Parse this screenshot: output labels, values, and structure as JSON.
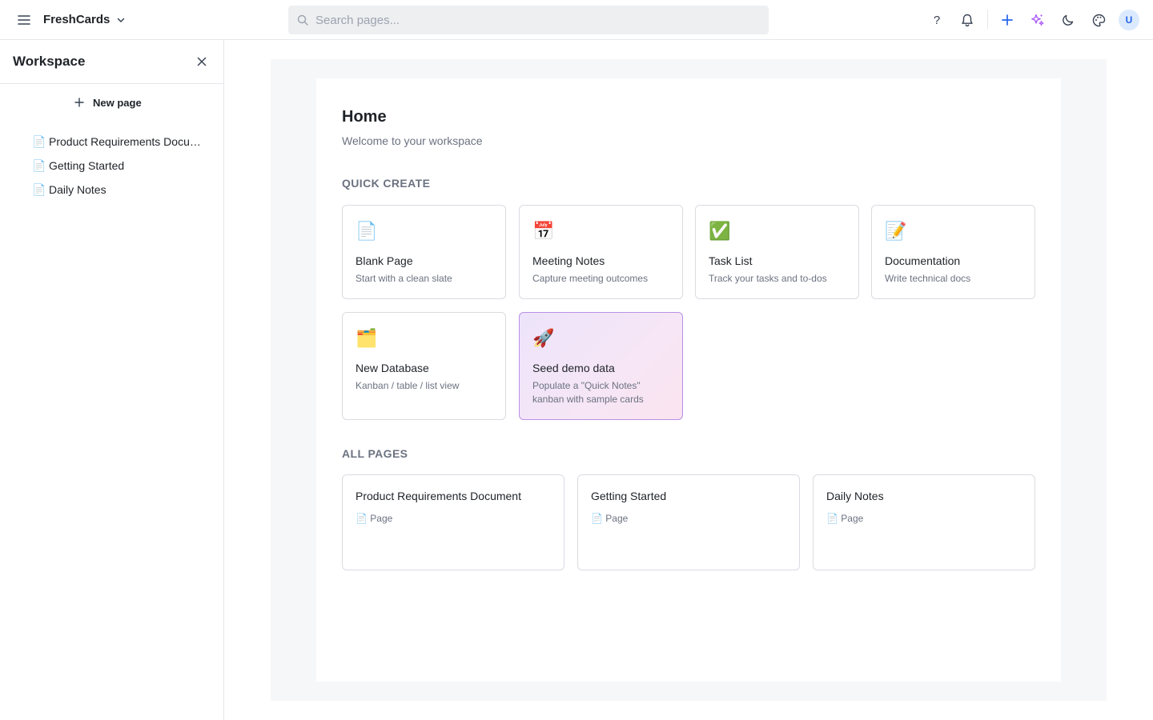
{
  "topbar": {
    "brand": "FreshCards",
    "search_placeholder": "Search pages...",
    "help_label": "?",
    "avatar_initial": "U"
  },
  "sidebar": {
    "title": "Workspace",
    "new_page_label": "New page",
    "pages": [
      {
        "icon": "📄",
        "label": "Product Requirements Document"
      },
      {
        "icon": "📄",
        "label": "Getting Started"
      },
      {
        "icon": "📄",
        "label": "Daily Notes"
      }
    ]
  },
  "main": {
    "title": "Home",
    "subtitle": "Welcome to your workspace",
    "quick_create_label": "QUICK CREATE",
    "quick_create": [
      {
        "icon": "📄",
        "name": "Blank Page",
        "desc": "Start with a clean slate"
      },
      {
        "icon": "📅",
        "name": "Meeting Notes",
        "desc": "Capture meeting outcomes"
      },
      {
        "icon": "✅",
        "name": "Task List",
        "desc": "Track your tasks and to-dos"
      },
      {
        "icon": "📝",
        "name": "Documentation",
        "desc": "Write technical docs"
      },
      {
        "icon": "🗂️",
        "name": "New Database",
        "desc": "Kanban / table / list view"
      },
      {
        "icon": "🚀",
        "name": "Seed demo data",
        "desc": "Populate a \"Quick Notes\" kanban with sample cards"
      }
    ],
    "all_pages_label": "ALL PAGES",
    "all_pages": [
      {
        "title": "Product Requirements Document",
        "type_icon": "📄",
        "type": "Page"
      },
      {
        "title": "Getting Started",
        "type_icon": "📄",
        "type": "Page"
      },
      {
        "title": "Daily Notes",
        "type_icon": "📄",
        "type": "Page"
      }
    ]
  },
  "colors": {
    "accent_blue": "#2563eb",
    "ai_purple": "#a855f7",
    "seed_card_border": "#b891e6"
  }
}
